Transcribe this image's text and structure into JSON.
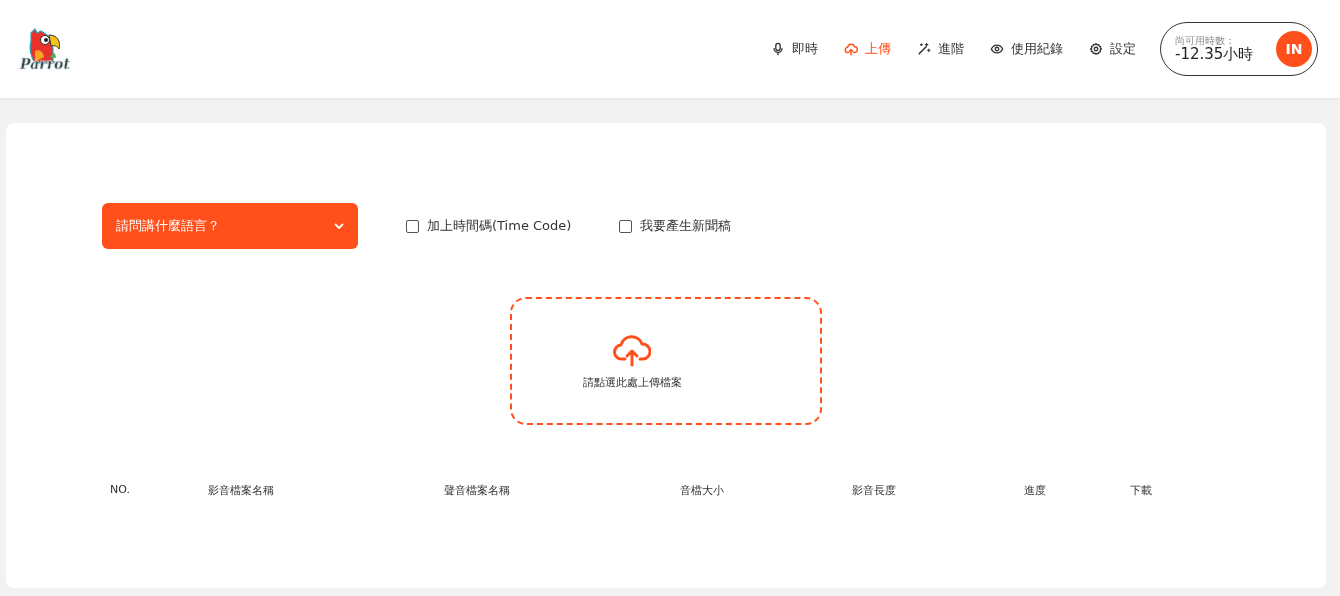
{
  "logo": {
    "text": "Parrot"
  },
  "nav": [
    {
      "label": "即時",
      "selected": false
    },
    {
      "label": "上傳",
      "selected": true
    },
    {
      "label": "進階",
      "selected": false
    },
    {
      "label": "使用紀錄",
      "selected": false
    },
    {
      "label": "設定",
      "selected": false
    }
  ],
  "credit": {
    "label": "尚可用時數：",
    "value": "-12.35",
    "unit": "小時",
    "avatar": "IN"
  },
  "language_select": {
    "placeholder": "請問講什麼語言？"
  },
  "options": [
    {
      "label": "加上時間碼(Time Code)",
      "checked": false
    },
    {
      "label": "我要產生新聞稿",
      "checked": false
    }
  ],
  "upload": {
    "label": "請點選此處上傳檔案"
  },
  "table": {
    "columns": [
      "NO.",
      "影音檔案名稱",
      "聲音檔案名稱",
      "音檔大小",
      "影音長度",
      "進度",
      "下載"
    ]
  }
}
